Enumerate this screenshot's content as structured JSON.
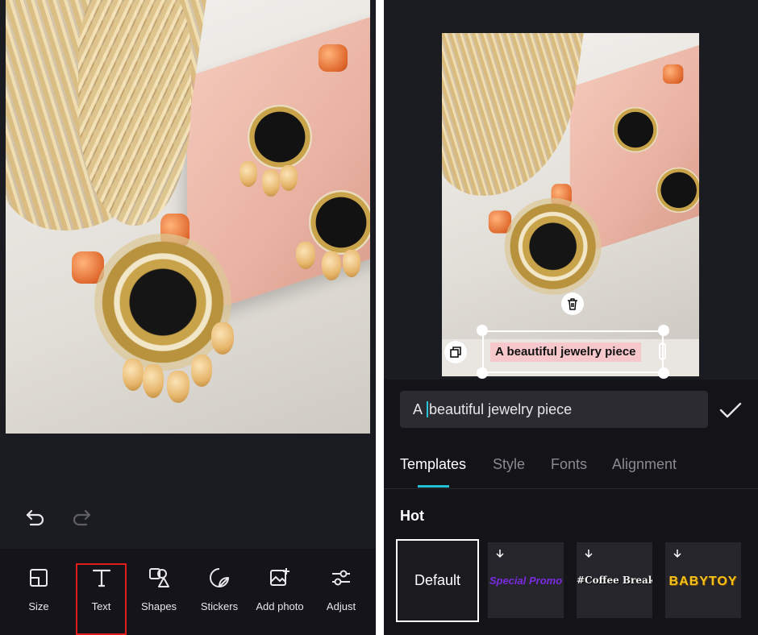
{
  "left": {
    "toolbar": {
      "items": [
        {
          "label": "Size",
          "icon": "size-icon"
        },
        {
          "label": "Text",
          "icon": "text-icon",
          "selected": true
        },
        {
          "label": "Shapes",
          "icon": "shapes-icon"
        },
        {
          "label": "Stickers",
          "icon": "stickers-icon"
        },
        {
          "label": "Add photo",
          "icon": "add-photo-icon"
        },
        {
          "label": "Adjust",
          "icon": "adjust-icon"
        }
      ]
    }
  },
  "right": {
    "overlay_text": "A beautiful jewelry piece",
    "input": {
      "before_caret": "A ",
      "after_caret": "beautiful jewelry piece"
    },
    "tabs": [
      {
        "label": "Templates",
        "active": true
      },
      {
        "label": "Style"
      },
      {
        "label": "Fonts"
      },
      {
        "label": "Alignment"
      }
    ],
    "section_title": "Hot",
    "templates": [
      {
        "label": "Default",
        "selected": true
      },
      {
        "label": "Special Promo",
        "color": "#7b2be0"
      },
      {
        "label": "#Coffee Break",
        "color": "#f2f2f2"
      },
      {
        "label": "BABYTOY",
        "color": "#f5c21b"
      }
    ]
  },
  "colors": {
    "background": "#1b1b22",
    "accent": "#22c1d6",
    "selection_red": "#e21c1c",
    "label_pink": "#f6c8cc"
  }
}
